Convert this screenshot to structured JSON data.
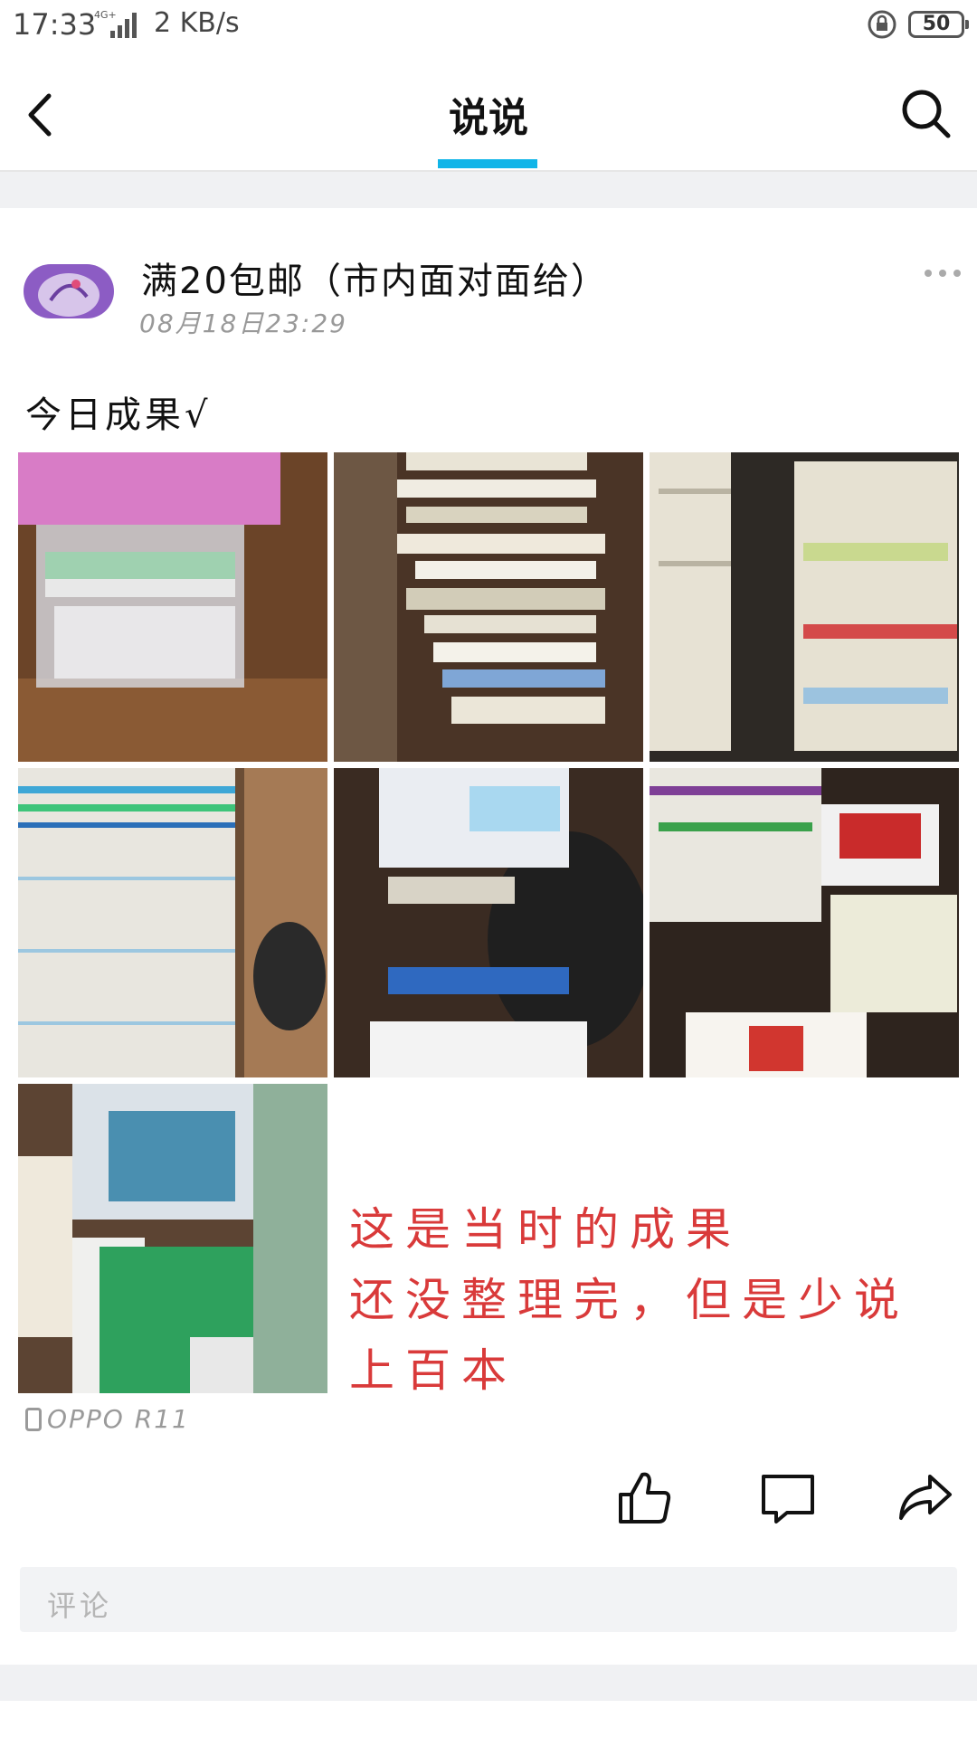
{
  "status_bar": {
    "time": "17:33",
    "network_speed": "2 KB/s",
    "signal_type": "4G+",
    "battery": "50"
  },
  "header": {
    "title": "说说",
    "back_icon": "chevron-left-icon",
    "search_icon": "search-icon",
    "accent_color": "#11b5e8"
  },
  "post": {
    "author": "满20包邮（市内面对面给）",
    "time": "08月18日23:29",
    "caption": "今日成果√",
    "photos": [
      "photo-1",
      "photo-2",
      "photo-3",
      "photo-4",
      "photo-5",
      "photo-6",
      "photo-7"
    ],
    "overlay_lines": [
      "这是当时的成果",
      "还没整理完，但是少说上百本"
    ],
    "overlay_color": "#d93a3a",
    "device": "OPPO R11"
  },
  "actions": {
    "like_icon": "thumbs-up-icon",
    "comment_icon": "comment-icon",
    "share_icon": "share-icon"
  },
  "comment": {
    "placeholder": "评论"
  }
}
